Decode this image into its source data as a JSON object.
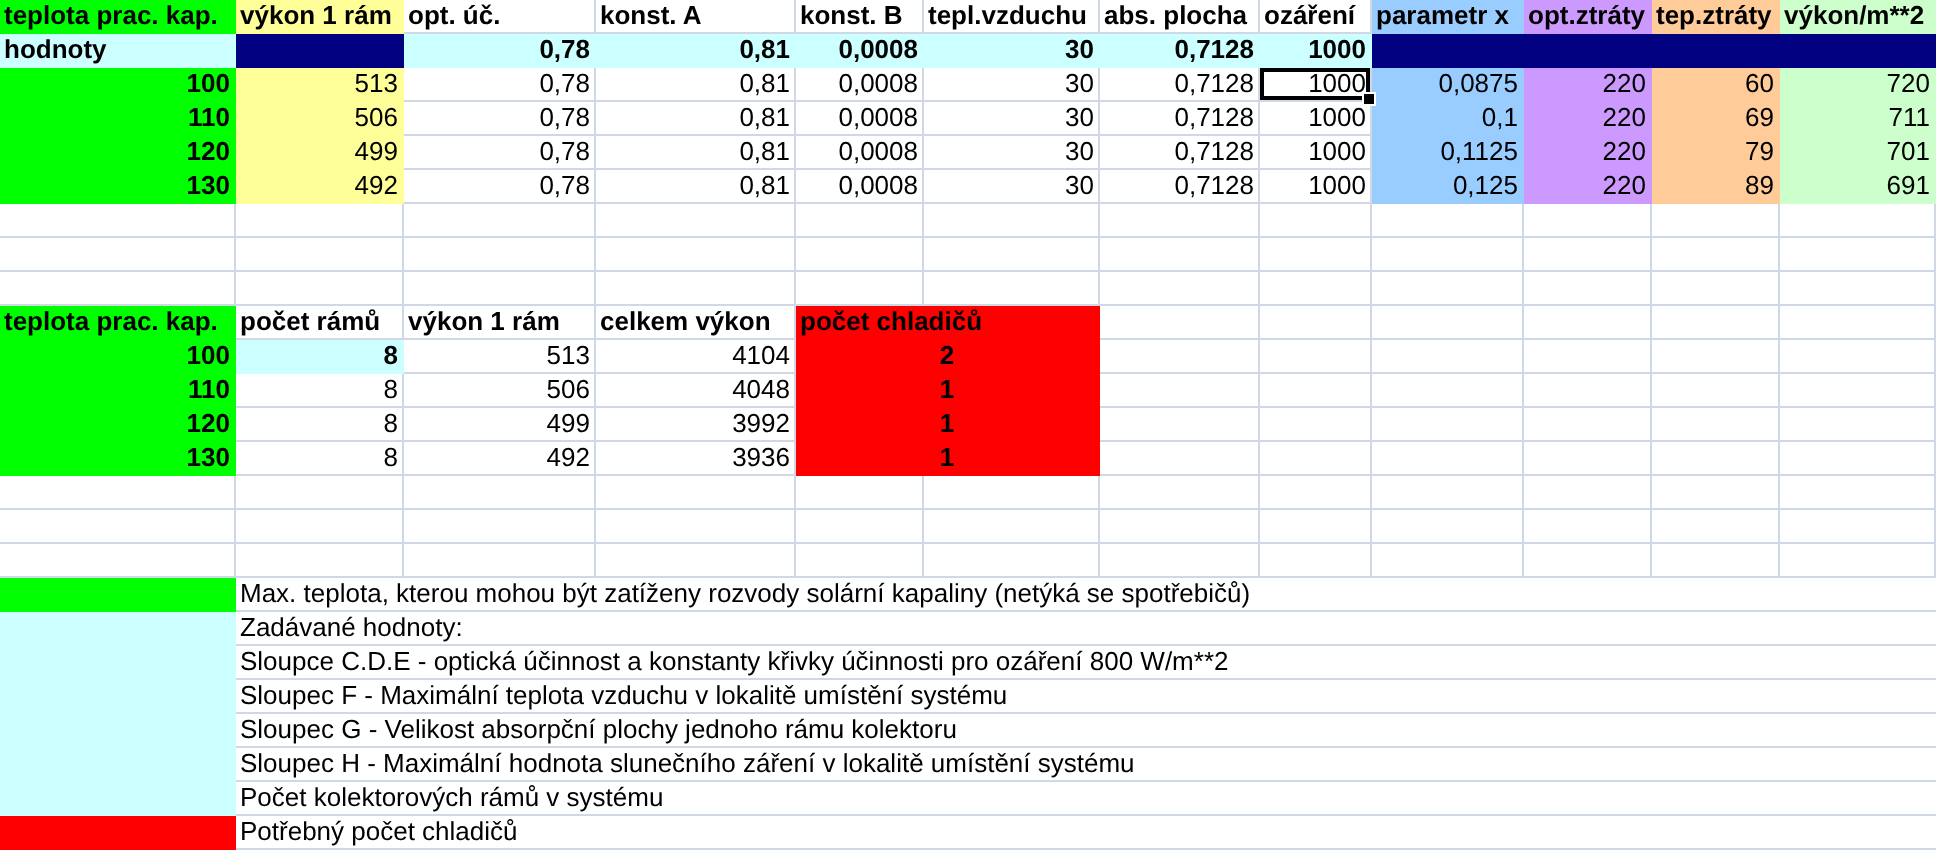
{
  "table1": {
    "columns": [
      {
        "label": "teplota prac. kap.",
        "color": "#00ff00",
        "bold": true
      },
      {
        "label": "výkon 1 rám",
        "color": "#ffff99",
        "bold": false
      },
      {
        "label": "opt. úč.",
        "color": "#ffffff",
        "bold": false
      },
      {
        "label": "konst. A",
        "color": "#ffffff",
        "bold": false
      },
      {
        "label": "konst. B",
        "color": "#ffffff",
        "bold": false
      },
      {
        "label": "tepl.vzduchu",
        "color": "#ffffff",
        "bold": false
      },
      {
        "label": "abs. plocha",
        "color": "#ffffff",
        "bold": false
      },
      {
        "label": "ozáření",
        "color": "#ffffff",
        "bold": false
      },
      {
        "label": "parametr x",
        "color": "#99ccff",
        "bold": false
      },
      {
        "label": "opt.ztráty",
        "color": "#cc99ff",
        "bold": false
      },
      {
        "label": "tep.ztráty",
        "color": "#ffcc99",
        "bold": false
      },
      {
        "label": "výkon/m**2",
        "color": "#ccffcc",
        "bold": false
      }
    ],
    "input_row": [
      {
        "text": "hodnoty",
        "color": "#ccffff"
      },
      {
        "color": "#000080"
      },
      {
        "text": "0,78",
        "color": "#ccffff"
      },
      {
        "text": "0,81",
        "color": "#ccffff"
      },
      {
        "text": "0,0008",
        "color": "#ccffff"
      },
      {
        "text": "30",
        "color": "#ccffff"
      },
      {
        "text": "0,7128",
        "color": "#ccffff"
      },
      {
        "text": "1000",
        "color": "#ccffff"
      },
      {
        "color": "#000080"
      },
      {
        "color": "#000080"
      },
      {
        "color": "#000080"
      },
      {
        "color": "#000080"
      }
    ],
    "rows": [
      [
        {
          "text": "100",
          "selected": false
        },
        {
          "text": "513",
          "selected": false
        },
        {
          "text": "0,78",
          "selected": false
        },
        {
          "text": "0,81",
          "selected": false
        },
        {
          "text": "0,0008",
          "selected": false
        },
        {
          "text": "30",
          "selected": false
        },
        {
          "text": "0,7128",
          "selected": false
        },
        {
          "text": "1000",
          "selected": true
        },
        {
          "text": "0,0875",
          "selected": false
        },
        {
          "text": "220",
          "selected": false
        },
        {
          "text": "60",
          "selected": false
        },
        {
          "text": "720",
          "selected": false
        }
      ],
      [
        {
          "text": "110",
          "selected": false
        },
        {
          "text": "506",
          "selected": false
        },
        {
          "text": "0,78",
          "selected": false
        },
        {
          "text": "0,81",
          "selected": false
        },
        {
          "text": "0,0008",
          "selected": false
        },
        {
          "text": "30",
          "selected": false
        },
        {
          "text": "0,7128",
          "selected": false
        },
        {
          "text": "1000",
          "selected": false
        },
        {
          "text": "0,1",
          "selected": false
        },
        {
          "text": "220",
          "selected": false
        },
        {
          "text": "69",
          "selected": false
        },
        {
          "text": "711",
          "selected": false
        }
      ],
      [
        {
          "text": "120",
          "selected": false
        },
        {
          "text": "499",
          "selected": false
        },
        {
          "text": "0,78",
          "selected": false
        },
        {
          "text": "0,81",
          "selected": false
        },
        {
          "text": "0,0008",
          "selected": false
        },
        {
          "text": "30",
          "selected": false
        },
        {
          "text": "0,7128",
          "selected": false
        },
        {
          "text": "1000",
          "selected": false
        },
        {
          "text": "0,1125",
          "selected": false
        },
        {
          "text": "220",
          "selected": false
        },
        {
          "text": "79",
          "selected": false
        },
        {
          "text": "701",
          "selected": false
        }
      ],
      [
        {
          "text": "130",
          "selected": false
        },
        {
          "text": "492",
          "selected": false
        },
        {
          "text": "0,78",
          "selected": false
        },
        {
          "text": "0,81",
          "selected": false
        },
        {
          "text": "0,0008",
          "selected": false
        },
        {
          "text": "30",
          "selected": false
        },
        {
          "text": "0,7128",
          "selected": false
        },
        {
          "text": "1000",
          "selected": false
        },
        {
          "text": "0,125",
          "selected": false
        },
        {
          "text": "220",
          "selected": false
        },
        {
          "text": "89",
          "selected": false
        },
        {
          "text": "691",
          "selected": false
        }
      ]
    ]
  },
  "table2": {
    "columns": [
      {
        "label": "teplota prac. kap.",
        "color": "#00ff00",
        "bold": true
      },
      {
        "label": "počet rámů",
        "color": "#ffffff",
        "bold": false
      },
      {
        "label": "výkon 1 rám",
        "color": "#ffffff",
        "bold": false
      },
      {
        "label": "celkem výkon",
        "color": "#ffffff",
        "bold": false
      },
      {
        "label": "počet chladičů",
        "color": "#ff0000",
        "bold": true
      }
    ],
    "rows": [
      [
        {
          "text": "100"
        },
        {
          "text": "8",
          "color": "#ccffff",
          "bold": true
        },
        {
          "text": "513"
        },
        {
          "text": "4104"
        },
        {
          "text": "2"
        }
      ],
      [
        {
          "text": "110"
        },
        {
          "text": "8"
        },
        {
          "text": "506"
        },
        {
          "text": "4048"
        },
        {
          "text": "1"
        }
      ],
      [
        {
          "text": "120"
        },
        {
          "text": "8"
        },
        {
          "text": "499"
        },
        {
          "text": "3992"
        },
        {
          "text": "1"
        }
      ],
      [
        {
          "text": "130"
        },
        {
          "text": "8"
        },
        {
          "text": "492"
        },
        {
          "text": "3936"
        },
        {
          "text": "1"
        }
      ]
    ]
  },
  "legend": [
    {
      "color": "#00ff00",
      "text": "Max. teplota, kterou mohou být zatíženy rozvody solární kapaliny (netýká se spotřebičů)"
    },
    {
      "color": "#ccffff",
      "text": "Zadávané hodnoty:"
    },
    {
      "color": "#ccffff",
      "text": "Sloupce C.D.E - optická účinnost a konstanty křivky účinnosti pro ozáření 800 W/m**2"
    },
    {
      "color": "#ccffff",
      "text": "Sloupec F - Maximální teplota vzduchu v lokalitě umístění systému"
    },
    {
      "color": "#ccffff",
      "text": "Sloupec G - Velikost absorpční plochy jednoho rámu kolektoru"
    },
    {
      "color": "#ccffff",
      "text": "Sloupec H - Maximální hodnota slunečního záření v lokalitě umístění systému"
    },
    {
      "color": "#ccffff",
      "text": "Počet kolektorových rámů v systému"
    },
    {
      "color": "#ff0000",
      "text": "Potřebný počet chladičů"
    }
  ]
}
